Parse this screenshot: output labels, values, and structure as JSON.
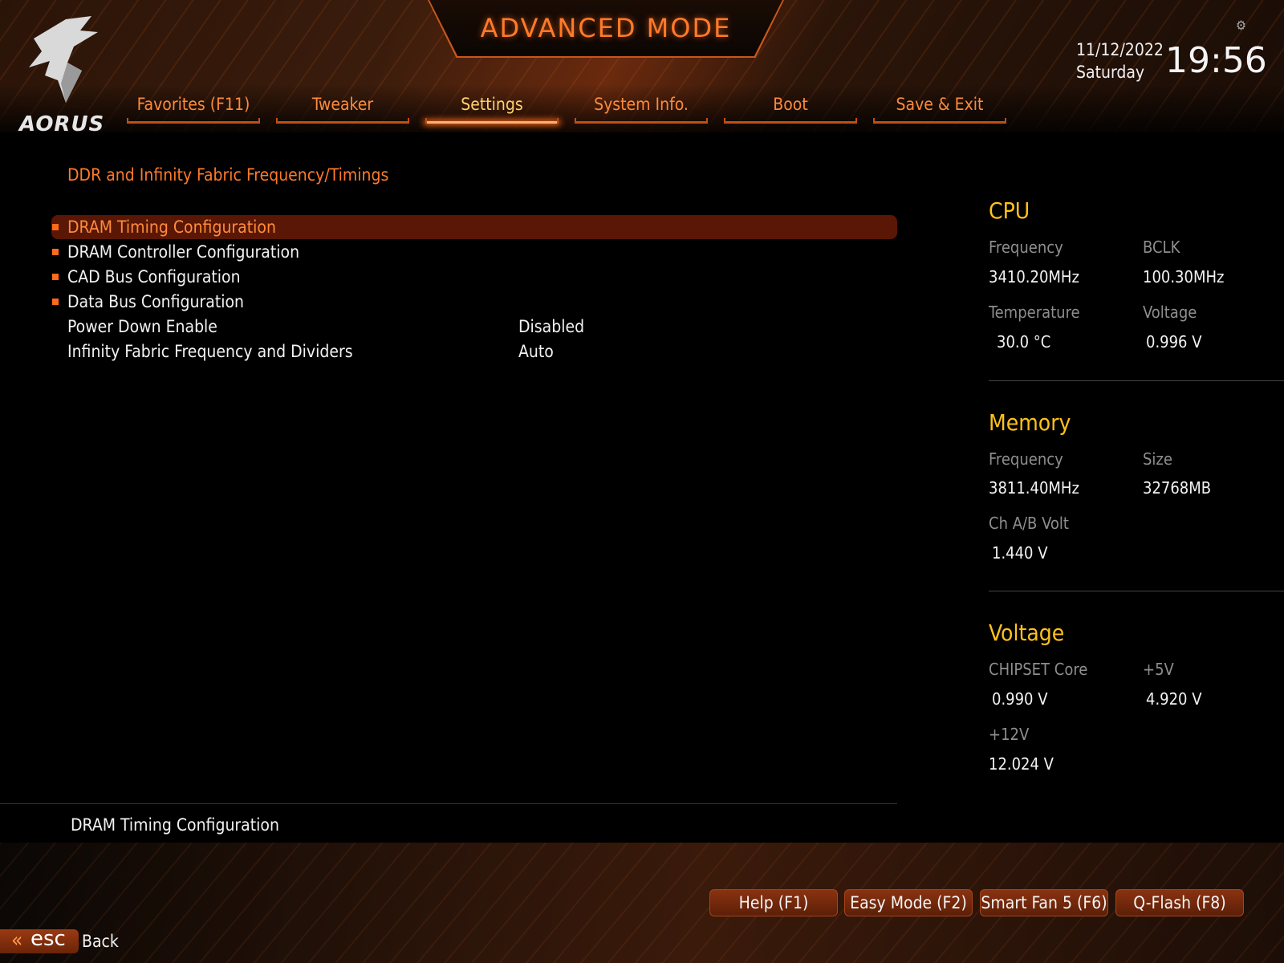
{
  "header": {
    "mode_title": "ADVANCED MODE",
    "brand": "AORUS",
    "date": "11/12/2022",
    "day": "Saturday",
    "time": "19:56"
  },
  "tabs": [
    {
      "label": "Favorites (F11)",
      "active": false
    },
    {
      "label": "Tweaker",
      "active": false
    },
    {
      "label": "Settings",
      "active": true
    },
    {
      "label": "System Info.",
      "active": false
    },
    {
      "label": "Boot",
      "active": false
    },
    {
      "label": "Save & Exit",
      "active": false
    }
  ],
  "breadcrumb": "DDR and Infinity Fabric Frequency/Timings",
  "menu": [
    {
      "label": "DRAM Timing Configuration",
      "submenu": true,
      "selected": true,
      "value": ""
    },
    {
      "label": "DRAM Controller Configuration",
      "submenu": true,
      "selected": false,
      "value": ""
    },
    {
      "label": "CAD Bus Configuration",
      "submenu": true,
      "selected": false,
      "value": ""
    },
    {
      "label": "Data Bus Configuration",
      "submenu": true,
      "selected": false,
      "value": ""
    },
    {
      "label": "Power Down Enable",
      "submenu": false,
      "selected": false,
      "value": "Disabled"
    },
    {
      "label": "Infinity Fabric Frequency and Dividers",
      "submenu": false,
      "selected": false,
      "value": "Auto"
    }
  ],
  "help_text": "DRAM Timing Configuration",
  "panel": {
    "cpu": {
      "title": "CPU",
      "frequency_label": "Frequency",
      "frequency": "3410.20MHz",
      "bclk_label": "BCLK",
      "bclk": "100.30MHz",
      "temperature_label": "Temperature",
      "temperature": "30.0 °C",
      "voltage_label": "Voltage",
      "voltage": "0.996 V"
    },
    "memory": {
      "title": "Memory",
      "frequency_label": "Frequency",
      "frequency": "3811.40MHz",
      "size_label": "Size",
      "size": "32768MB",
      "volt_label": "Ch A/B Volt",
      "volt": "1.440 V"
    },
    "voltage": {
      "title": "Voltage",
      "chipset_label": "CHIPSET Core",
      "chipset": "0.990 V",
      "v5_label": "+5V",
      "v5": "4.920 V",
      "v12_label": "+12V",
      "v12": "12.024 V"
    }
  },
  "footer": {
    "buttons": [
      "Help (F1)",
      "Easy Mode (F2)",
      "Smart Fan 5 (F6)",
      "Q-Flash (F8)"
    ],
    "esc_label": "esc",
    "back_label": "Back"
  },
  "colors": {
    "accent_orange": "#ff7a2a",
    "selected_row": "#5a1706",
    "panel_title": "#ffc21a",
    "active_tab": "#ffd36a"
  }
}
